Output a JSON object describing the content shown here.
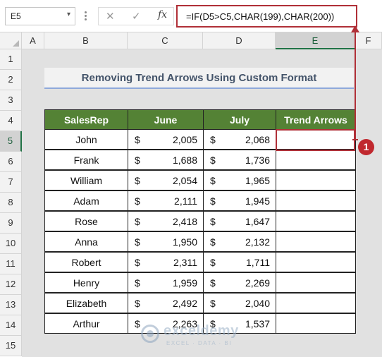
{
  "formula_bar": {
    "name_box": "E5",
    "name_box_dropdown_icon": "chevron-down-icon",
    "cancel_icon": "✕",
    "enter_icon": "✓",
    "fx_label": "fx",
    "formula": "=IF(D5>C5,CHAR(199),CHAR(200))"
  },
  "columns": [
    "A",
    "B",
    "C",
    "D",
    "E",
    "F"
  ],
  "rows": [
    "1",
    "2",
    "3",
    "4",
    "5",
    "6",
    "7",
    "8",
    "9",
    "10",
    "11",
    "12",
    "13",
    "14",
    "15"
  ],
  "title": "Removing Trend Arrows Using Custom Format",
  "table": {
    "headers": [
      "SalesRep",
      "June",
      "July",
      "Trend Arrows"
    ],
    "currency_symbol": "$",
    "rows": [
      {
        "name": "John",
        "june": "2,005",
        "july": "2,068"
      },
      {
        "name": "Frank",
        "june": "1,688",
        "july": "1,736"
      },
      {
        "name": "William",
        "june": "2,054",
        "july": "1,965"
      },
      {
        "name": "Adam",
        "june": "2,111",
        "july": "1,945"
      },
      {
        "name": "Rose",
        "june": "2,418",
        "july": "1,647"
      },
      {
        "name": "Anna",
        "june": "1,950",
        "july": "2,132"
      },
      {
        "name": "Robert",
        "june": "2,311",
        "july": "1,711"
      },
      {
        "name": "Henry",
        "june": "1,959",
        "july": "2,269"
      },
      {
        "name": "Elizabeth",
        "june": "2,492",
        "july": "2,040"
      },
      {
        "name": "Arthur",
        "june": "2,263",
        "july": "1,537"
      }
    ]
  },
  "callout": {
    "number": "1"
  },
  "watermark": {
    "brand": "exceldemy",
    "tagline": "EXCEL · DATA · BI"
  },
  "colors": {
    "header_green": "#548235",
    "accent_red": "#b03038",
    "title_text": "#44546a"
  }
}
